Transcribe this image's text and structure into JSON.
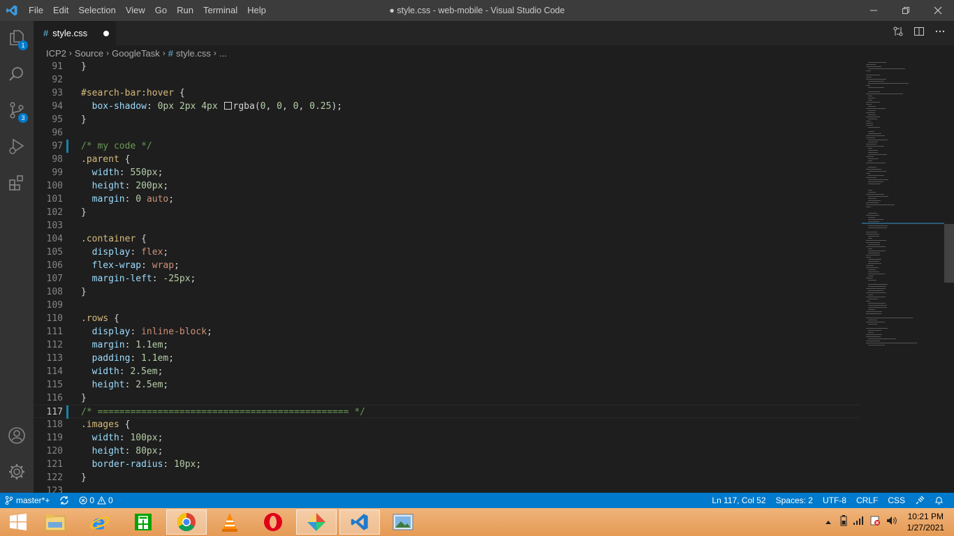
{
  "window": {
    "title": "● style.css - web-mobile - Visual Studio Code",
    "menu": [
      "File",
      "Edit",
      "Selection",
      "View",
      "Go",
      "Run",
      "Terminal",
      "Help"
    ]
  },
  "activity_bar": {
    "items": [
      {
        "icon": "files-icon",
        "badge": "1"
      },
      {
        "icon": "search-icon",
        "badge": ""
      },
      {
        "icon": "source-control-icon",
        "badge": "3"
      },
      {
        "icon": "run-debug-icon",
        "badge": ""
      },
      {
        "icon": "extensions-icon",
        "badge": ""
      }
    ],
    "bottom": [
      {
        "icon": "account-icon"
      },
      {
        "icon": "gear-icon"
      }
    ]
  },
  "tab": {
    "name": "style.css",
    "icon": "#"
  },
  "breadcrumb": [
    "ICP2",
    "Source",
    "GoogleTask",
    "style.css",
    "..."
  ],
  "breadcrumb_file_icon": "#",
  "editor": {
    "current_line": 117,
    "modified_lines": [
      97,
      117
    ]
  },
  "status": {
    "branch": "master*+",
    "errors": "0",
    "warnings": "0",
    "position": "Ln 117, Col 52",
    "spaces": "Spaces: 2",
    "encoding": "UTF-8",
    "eol": "CRLF",
    "language": "CSS"
  },
  "taskbar": {
    "apps": [
      "file-explorer-icon",
      "internet-explorer-icon",
      "store-icon",
      "chrome-icon",
      "vlc-icon",
      "opera-icon",
      "app-icon",
      "vscode-icon",
      "photos-icon"
    ],
    "time": "10:21 PM",
    "date": "1/27/2021"
  },
  "code_lines": [
    {
      "n": 91,
      "tokens": [
        [
          "pn",
          "}"
        ]
      ]
    },
    {
      "n": 92,
      "tokens": []
    },
    {
      "n": 93,
      "tokens": [
        [
          "sel",
          "#search-bar:hover"
        ],
        [
          "pn",
          " {"
        ]
      ]
    },
    {
      "n": 94,
      "tokens": [
        [
          "pn",
          "  "
        ],
        [
          "prop",
          "box-shadow"
        ],
        [
          "pn",
          ": "
        ],
        [
          "num",
          "0px"
        ],
        [
          "pn",
          " "
        ],
        [
          "num",
          "2px"
        ],
        [
          "pn",
          " "
        ],
        [
          "num",
          "4px"
        ],
        [
          "pn",
          " "
        ],
        [
          "swatch",
          ""
        ],
        [
          "pn",
          "rgba("
        ],
        [
          "num",
          "0"
        ],
        [
          "pn",
          ", "
        ],
        [
          "num",
          "0"
        ],
        [
          "pn",
          ", "
        ],
        [
          "num",
          "0"
        ],
        [
          "pn",
          ", "
        ],
        [
          "num",
          "0.25"
        ],
        [
          "pn",
          ");"
        ]
      ]
    },
    {
      "n": 95,
      "tokens": [
        [
          "pn",
          "}"
        ]
      ]
    },
    {
      "n": 96,
      "tokens": []
    },
    {
      "n": 97,
      "tokens": [
        [
          "cm",
          "/* my code */"
        ]
      ]
    },
    {
      "n": 98,
      "tokens": [
        [
          "sel",
          ".parent"
        ],
        [
          "pn",
          " {"
        ]
      ]
    },
    {
      "n": 99,
      "tokens": [
        [
          "pn",
          "  "
        ],
        [
          "prop",
          "width"
        ],
        [
          "pn",
          ": "
        ],
        [
          "num",
          "550px"
        ],
        [
          "pn",
          ";"
        ]
      ]
    },
    {
      "n": 100,
      "tokens": [
        [
          "pn",
          "  "
        ],
        [
          "prop",
          "height"
        ],
        [
          "pn",
          ": "
        ],
        [
          "num",
          "200px"
        ],
        [
          "pn",
          ";"
        ]
      ]
    },
    {
      "n": 101,
      "tokens": [
        [
          "pn",
          "  "
        ],
        [
          "prop",
          "margin"
        ],
        [
          "pn",
          ": "
        ],
        [
          "num",
          "0"
        ],
        [
          "pn",
          " "
        ],
        [
          "val",
          "auto"
        ],
        [
          "pn",
          ";"
        ]
      ]
    },
    {
      "n": 102,
      "tokens": [
        [
          "pn",
          "}"
        ]
      ]
    },
    {
      "n": 103,
      "tokens": []
    },
    {
      "n": 104,
      "tokens": [
        [
          "sel",
          ".container"
        ],
        [
          "pn",
          " {"
        ]
      ]
    },
    {
      "n": 105,
      "tokens": [
        [
          "pn",
          "  "
        ],
        [
          "prop",
          "display"
        ],
        [
          "pn",
          ": "
        ],
        [
          "val",
          "flex"
        ],
        [
          "pn",
          ";"
        ]
      ]
    },
    {
      "n": 106,
      "tokens": [
        [
          "pn",
          "  "
        ],
        [
          "prop",
          "flex-wrap"
        ],
        [
          "pn",
          ": "
        ],
        [
          "val",
          "wrap"
        ],
        [
          "pn",
          ";"
        ]
      ]
    },
    {
      "n": 107,
      "tokens": [
        [
          "pn",
          "  "
        ],
        [
          "prop",
          "margin-left"
        ],
        [
          "pn",
          ": "
        ],
        [
          "num",
          "-25px"
        ],
        [
          "pn",
          ";"
        ]
      ]
    },
    {
      "n": 108,
      "tokens": [
        [
          "pn",
          "}"
        ]
      ]
    },
    {
      "n": 109,
      "tokens": []
    },
    {
      "n": 110,
      "tokens": [
        [
          "sel",
          ".rows"
        ],
        [
          "pn",
          " {"
        ]
      ]
    },
    {
      "n": 111,
      "tokens": [
        [
          "pn",
          "  "
        ],
        [
          "prop",
          "display"
        ],
        [
          "pn",
          ": "
        ],
        [
          "val",
          "inline-block"
        ],
        [
          "pn",
          ";"
        ]
      ]
    },
    {
      "n": 112,
      "tokens": [
        [
          "pn",
          "  "
        ],
        [
          "prop",
          "margin"
        ],
        [
          "pn",
          ": "
        ],
        [
          "num",
          "1.1em"
        ],
        [
          "pn",
          ";"
        ]
      ]
    },
    {
      "n": 113,
      "tokens": [
        [
          "pn",
          "  "
        ],
        [
          "prop",
          "padding"
        ],
        [
          "pn",
          ": "
        ],
        [
          "num",
          "1.1em"
        ],
        [
          "pn",
          ";"
        ]
      ]
    },
    {
      "n": 114,
      "tokens": [
        [
          "pn",
          "  "
        ],
        [
          "prop",
          "width"
        ],
        [
          "pn",
          ": "
        ],
        [
          "num",
          "2.5em"
        ],
        [
          "pn",
          ";"
        ]
      ]
    },
    {
      "n": 115,
      "tokens": [
        [
          "pn",
          "  "
        ],
        [
          "prop",
          "height"
        ],
        [
          "pn",
          ": "
        ],
        [
          "num",
          "2.5em"
        ],
        [
          "pn",
          ";"
        ]
      ]
    },
    {
      "n": 116,
      "tokens": [
        [
          "pn",
          "}"
        ]
      ]
    },
    {
      "n": 117,
      "tokens": [
        [
          "cm",
          "/* ============================================== */"
        ]
      ]
    },
    {
      "n": 118,
      "tokens": [
        [
          "sel",
          ".images"
        ],
        [
          "pn",
          " {"
        ]
      ]
    },
    {
      "n": 119,
      "tokens": [
        [
          "pn",
          "  "
        ],
        [
          "prop",
          "width"
        ],
        [
          "pn",
          ": "
        ],
        [
          "num",
          "100px"
        ],
        [
          "pn",
          ";"
        ]
      ]
    },
    {
      "n": 120,
      "tokens": [
        [
          "pn",
          "  "
        ],
        [
          "prop",
          "height"
        ],
        [
          "pn",
          ": "
        ],
        [
          "num",
          "80px"
        ],
        [
          "pn",
          ";"
        ]
      ]
    },
    {
      "n": 121,
      "tokens": [
        [
          "pn",
          "  "
        ],
        [
          "prop",
          "border-radius"
        ],
        [
          "pn",
          ": "
        ],
        [
          "num",
          "10px"
        ],
        [
          "pn",
          ";"
        ]
      ]
    },
    {
      "n": 122,
      "tokens": [
        [
          "pn",
          "}"
        ]
      ]
    },
    {
      "n": 123,
      "tokens": []
    }
  ]
}
